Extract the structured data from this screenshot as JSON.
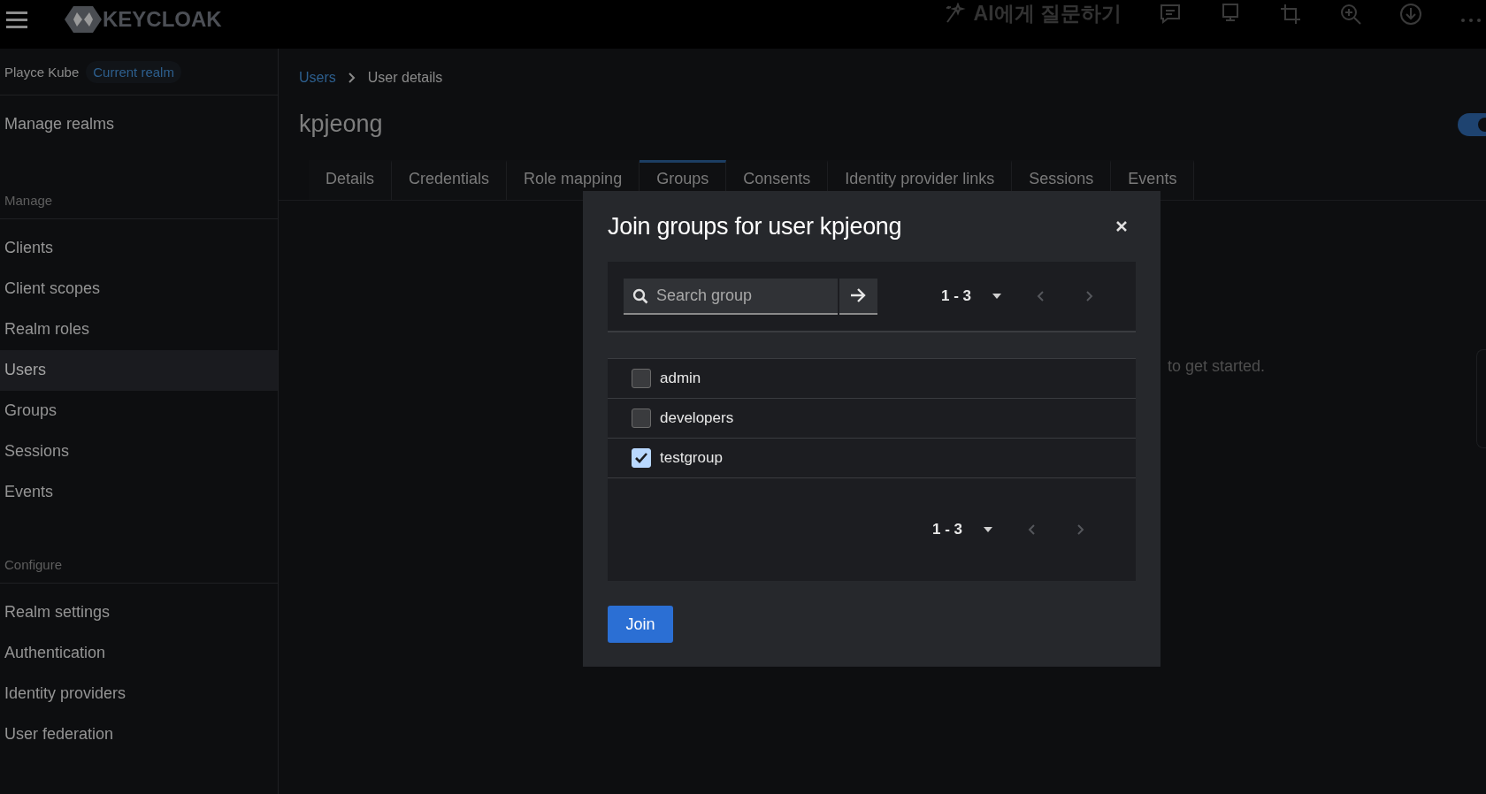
{
  "top_bar": {
    "logo": "KEYCLOAK",
    "assistant_label": "AI에게 질문하기"
  },
  "sidebar": {
    "realm": "Playce Kube",
    "realm_badge": "Current realm",
    "manage_realms": "Manage realms",
    "sections": [
      {
        "heading": "Manage",
        "items": [
          {
            "label": "Clients",
            "selected": false
          },
          {
            "label": "Client scopes",
            "selected": false
          },
          {
            "label": "Realm roles",
            "selected": false
          },
          {
            "label": "Users",
            "selected": true
          },
          {
            "label": "Groups",
            "selected": false
          },
          {
            "label": "Sessions",
            "selected": false
          },
          {
            "label": "Events",
            "selected": false
          }
        ]
      },
      {
        "heading": "Configure",
        "items": [
          {
            "label": "Realm settings",
            "selected": false
          },
          {
            "label": "Authentication",
            "selected": false
          },
          {
            "label": "Identity providers",
            "selected": false
          },
          {
            "label": "User federation",
            "selected": false
          }
        ]
      }
    ]
  },
  "breadcrumb": [
    {
      "label": "Users",
      "kind": "link"
    },
    {
      "label": "User details",
      "kind": "current"
    }
  ],
  "page_title": "kpjeong",
  "enabled_toggle": {
    "on": true
  },
  "tabs": [
    {
      "label": "Details",
      "selected": false
    },
    {
      "label": "Credentials",
      "selected": false
    },
    {
      "label": "Role mapping",
      "selected": false
    },
    {
      "label": "Groups",
      "selected": true
    },
    {
      "label": "Consents",
      "selected": false
    },
    {
      "label": "Identity provider links",
      "selected": false
    },
    {
      "label": "Sessions",
      "selected": false
    },
    {
      "label": "Events",
      "selected": false
    }
  ],
  "empty_state_text": "to get started.",
  "dialog": {
    "title": "Join groups for user kpjeong",
    "search": {
      "placeholder": "Search group"
    },
    "pagination_top": {
      "range": "1 - 3",
      "prev_disabled": true,
      "next_disabled": true
    },
    "groups": [
      {
        "name": "admin",
        "checked": false
      },
      {
        "name": "developers",
        "checked": false
      },
      {
        "name": "testgroup",
        "checked": true
      }
    ],
    "pagination_bottom": {
      "range": "1 - 3",
      "prev_disabled": true,
      "next_disabled": true
    },
    "join_button": "Join"
  }
}
